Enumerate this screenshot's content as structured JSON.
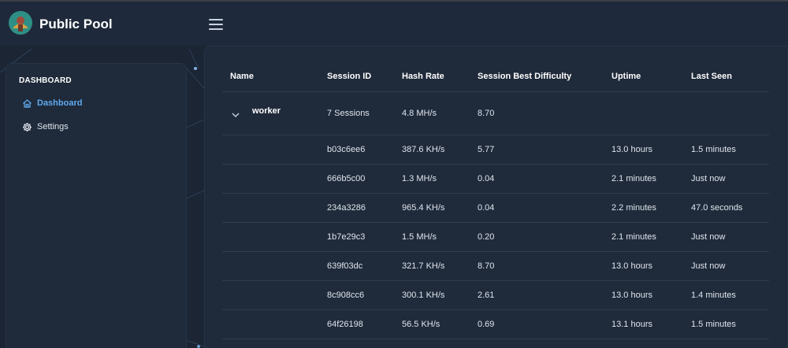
{
  "app": {
    "title": "Public Pool"
  },
  "sidebar": {
    "heading": "DASHBOARD",
    "items": [
      {
        "label": "Dashboard",
        "icon": "home-icon",
        "active": true
      },
      {
        "label": "Settings",
        "icon": "gear-icon",
        "active": false
      }
    ]
  },
  "table": {
    "columns": [
      "Name",
      "Session ID",
      "Hash Rate",
      "Session Best Difficulty",
      "Uptime",
      "Last Seen"
    ],
    "group": {
      "name": "worker",
      "session_id": "7 Sessions",
      "hash_rate": "4.8 MH/s",
      "best_difficulty": "8.70",
      "uptime": "",
      "last_seen": ""
    },
    "rows": [
      {
        "session_id": "b03c6ee6",
        "hash_rate": "387.6 KH/s",
        "best_difficulty": "5.77",
        "uptime": "13.0 hours",
        "last_seen": "1.5 minutes"
      },
      {
        "session_id": "666b5c00",
        "hash_rate": "1.3 MH/s",
        "best_difficulty": "0.04",
        "uptime": "2.1 minutes",
        "last_seen": "Just now"
      },
      {
        "session_id": "234a3286",
        "hash_rate": "965.4 KH/s",
        "best_difficulty": "0.04",
        "uptime": "2.2 minutes",
        "last_seen": "47.0 seconds"
      },
      {
        "session_id": "1b7e29c3",
        "hash_rate": "1.5 MH/s",
        "best_difficulty": "0.20",
        "uptime": "2.1 minutes",
        "last_seen": "Just now"
      },
      {
        "session_id": "639f03dc",
        "hash_rate": "321.7 KH/s",
        "best_difficulty": "8.70",
        "uptime": "13.0 hours",
        "last_seen": "Just now"
      },
      {
        "session_id": "8c908cc6",
        "hash_rate": "300.1 KH/s",
        "best_difficulty": "2.61",
        "uptime": "13.0 hours",
        "last_seen": "1.4 minutes"
      },
      {
        "session_id": "64f26198",
        "hash_rate": "56.5 KH/s",
        "best_difficulty": "0.69",
        "uptime": "13.1 hours",
        "last_seen": "1.5 minutes"
      }
    ]
  },
  "colors": {
    "background": "#1b2533",
    "panel": "#1f2a3a",
    "accent": "#5fa9ee"
  }
}
